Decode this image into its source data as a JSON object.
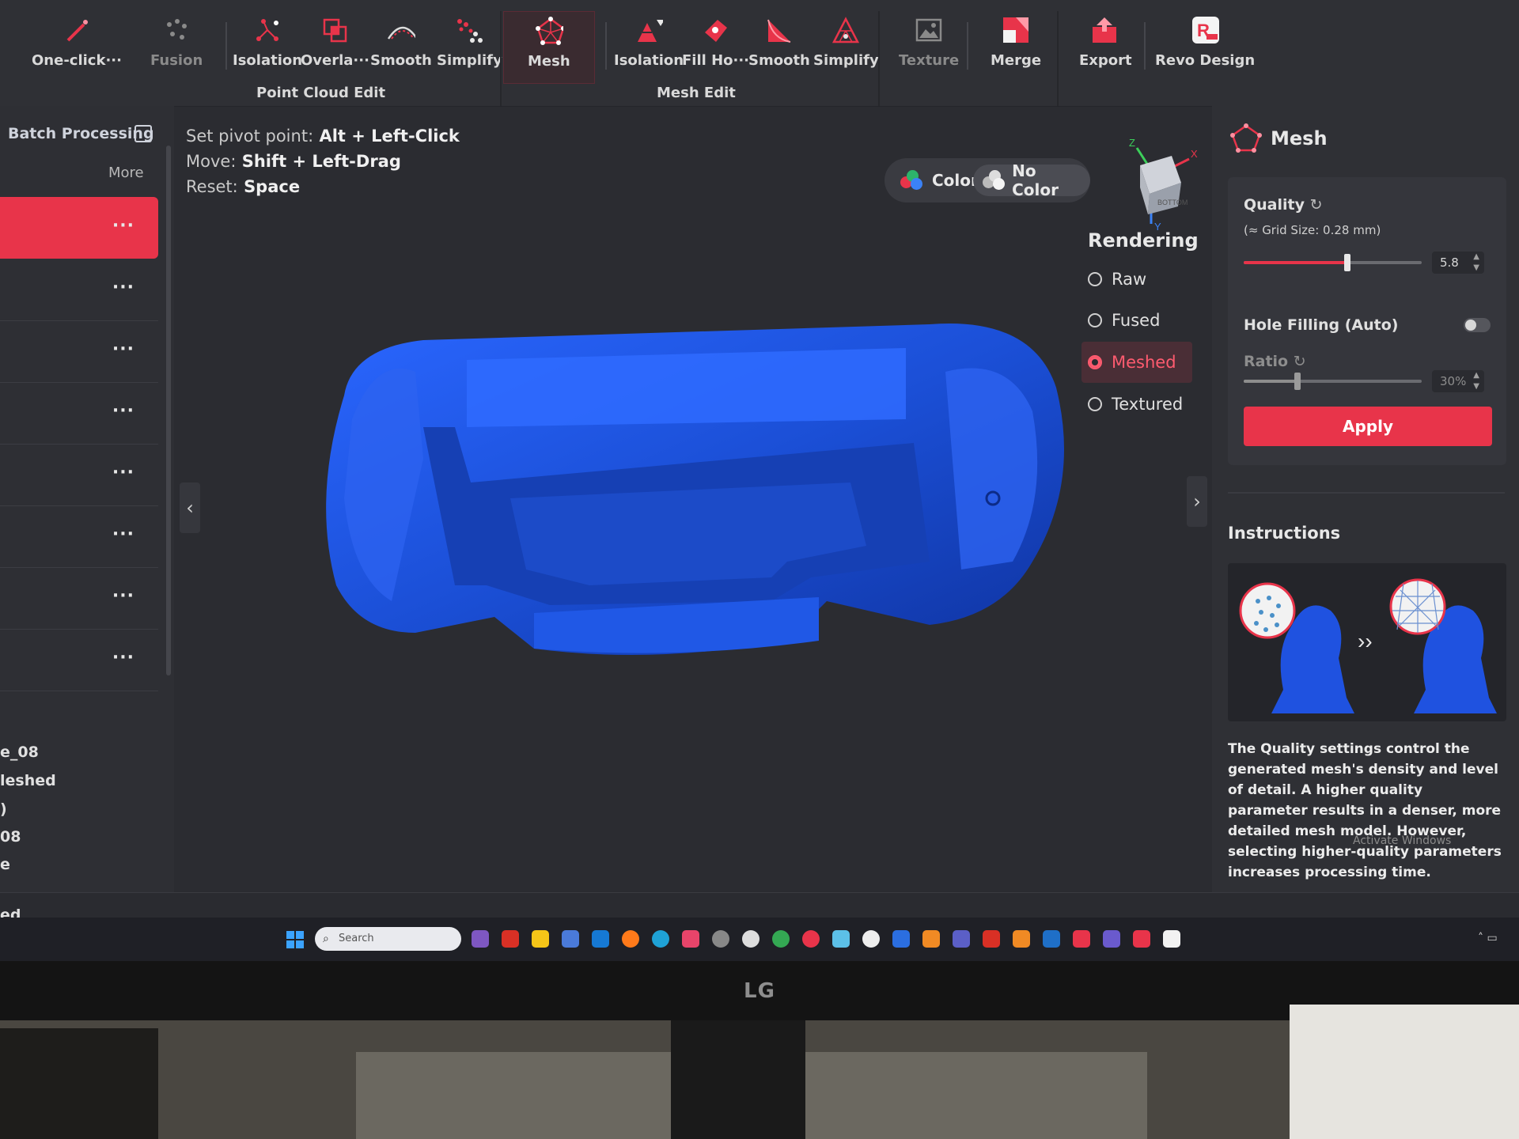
{
  "toolbar": {
    "tools": [
      {
        "label": "One-click···",
        "icon": "wand-icon"
      },
      {
        "label": "Fusion",
        "icon": "fusion-dots-icon"
      },
      {
        "label": "Isolation",
        "icon": "isolation-points-icon"
      },
      {
        "label": "Overla···",
        "icon": "overlap-squares-icon"
      },
      {
        "label": "Smooth",
        "icon": "smooth-curve-icon"
      },
      {
        "label": "Simplify",
        "icon": "simplify-dots-icon"
      },
      {
        "label": "Mesh",
        "icon": "mesh-icon"
      },
      {
        "label": "Isolation",
        "icon": "mesh-isolation-icon"
      },
      {
        "label": "Fill Ho···",
        "icon": "fill-holes-icon"
      },
      {
        "label": "Smooth",
        "icon": "mesh-smooth-icon"
      },
      {
        "label": "Simplify",
        "icon": "mesh-simplify-icon"
      },
      {
        "label": "Texture",
        "icon": "texture-icon"
      },
      {
        "label": "Merge",
        "icon": "merge-icon"
      },
      {
        "label": "Export",
        "icon": "export-icon"
      },
      {
        "label": "Revo Design",
        "icon": "revo-design-icon"
      }
    ],
    "groups": {
      "point_cloud": "Point Cloud Edit",
      "mesh_edit": "Mesh Edit"
    }
  },
  "left_panel": {
    "title": "Batch Processing",
    "more": "More",
    "row_menu": "···",
    "items": [
      "e_08",
      "leshed",
      ")",
      "08",
      "e"
    ],
    "status": "ed"
  },
  "viewport": {
    "hints": [
      {
        "key": "Set pivot point:",
        "value": "Alt + Left-Click"
      },
      {
        "key": "Move:",
        "value": "Shift + Left-Drag"
      },
      {
        "key": "Reset:",
        "value": "Space"
      }
    ],
    "color_toggle": {
      "color": "Color",
      "no_color": "No Color"
    },
    "axis": {
      "x": "X",
      "y": "Y",
      "z": "Z",
      "face": "BOTTOM"
    },
    "rendering": {
      "title": "Rendering",
      "options": [
        "Raw",
        "Fused",
        "Meshed",
        "Textured"
      ],
      "selected": "Meshed"
    },
    "model_color": "#1f52e0",
    "nav_left": "‹",
    "nav_right": "›"
  },
  "right_panel": {
    "title": "Mesh",
    "quality": {
      "label": "Quality",
      "grid_size": "(≈ Grid Size: 0.28 mm)",
      "value": "5.8",
      "level": 0.58
    },
    "hole_filling": {
      "label": "Hole Filling (Auto)",
      "on": false
    },
    "ratio": {
      "label": "Ratio",
      "value": "30%",
      "level": 0.3
    },
    "apply": "Apply",
    "instructions_title": "Instructions",
    "instructions_text": "The Quality settings control the generated mesh's density and level of detail. A higher quality parameter results in a denser, more detailed mesh model. However, selecting higher-quality parameters increases processing time.",
    "watermark": "Activate Windows"
  },
  "taskbar": {
    "search_placeholder": "Search"
  },
  "monitor": {
    "brand": "LG"
  },
  "colors": {
    "accent": "#e8344a",
    "mesh_blue": "#1f52e0"
  }
}
